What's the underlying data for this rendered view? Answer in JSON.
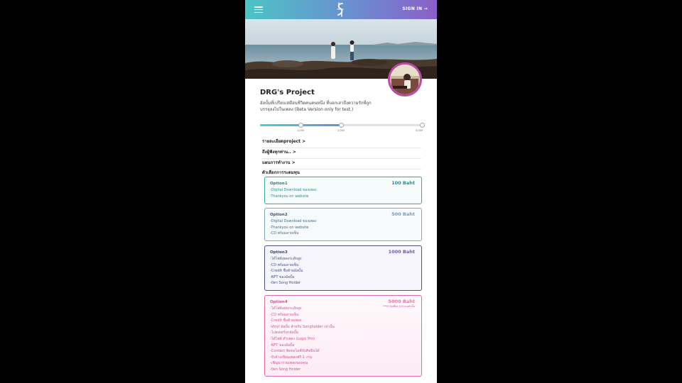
{
  "header": {
    "sign_in_label": "SIGN IN →"
  },
  "project": {
    "title": "DRG's Project",
    "description": "อัลบั้มที่เปรียบเสมือนชีวิตคนคนหนึ่ง ที่บอกเล่าถึงความรักที่ถูกบรรจุลงไปในเพลง (Beta Version only for test.)"
  },
  "progress": {
    "fill_fraction": 0.5,
    "markers": [
      {
        "label": "1,000",
        "fraction": 0.25
      },
      {
        "label": "2,000",
        "fraction": 0.5
      },
      {
        "label": "4,000",
        "fraction": 1.0
      }
    ]
  },
  "nav": {
    "details": "รายละเอียดproject >",
    "thanks": "ถึงผู้ฟังทุกท่าน.. >",
    "plan": "แผนการทำงาน >",
    "options_heading": "ตัวเลือกการระดมทุน"
  },
  "options": [
    {
      "title": "Option1",
      "price": "100 Baht",
      "note": "",
      "items": [
        "-Digital Download ของเพลง",
        "-Thankyou on website"
      ]
    },
    {
      "title": "Option2",
      "price": "500 Baht",
      "note": "",
      "items": [
        "-Digital Download ของเพลง",
        "-Thankyou on website",
        "-CD พร้อมลายเซ็น"
      ]
    },
    {
      "title": "Option3",
      "price": "1000 Baht",
      "note": "",
      "items": [
        "-ได้ไฟล์เพลงระดับสูง",
        "-CD พร้อมลายเซ็น",
        "-Credit ชื่อท้ายอัลบั้ม",
        "-NFT ของอัลบั้ม",
        "-บัตร Song Holder"
      ]
    },
    {
      "title": "Option4",
      "price": "5000 Baht",
      "note": "***จำกัดเพียง 100 คนเท่านั้น",
      "items": [
        "-ได้ไฟล์เพลงระดับสูง",
        "-CD พร้อมลายเซ็น",
        "-Credit ชื่อท้ายเพลง",
        "-Vinyl อัลบั้ม สำหรับ Songholder เท่านั้น",
        "-โปสเตอร์ทุกอัลบั้ม",
        "-ได้ไฟล์ ทำเพลง (Logic Pro)",
        "-NFT ของอัลบั้ม",
        "-Contact ติดต่อไลฟ์กับศิลปินได้",
        "-รับจ้างเขียนเพลงฟรี 1 งาน",
        "-เชิญมาร่วมเพลงของคุณ",
        "-บัตร Song Holder"
      ]
    }
  ]
}
